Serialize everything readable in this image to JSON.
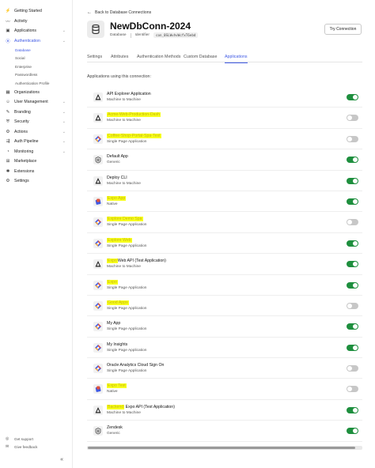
{
  "sidebar": {
    "items": [
      {
        "label": "Getting Started",
        "icon": "bolt-icon",
        "glyph": "⚡",
        "chevron": false
      },
      {
        "label": "Activity",
        "icon": "activity-icon",
        "glyph": "〰",
        "chevron": false
      },
      {
        "label": "Applications",
        "icon": "applications-icon",
        "glyph": "▣",
        "chevron": true
      },
      {
        "label": "Authentication",
        "icon": "authentication-icon",
        "glyph": "⦿",
        "chevron": true,
        "active": true
      }
    ],
    "sub_items": [
      {
        "label": "Database",
        "active": true
      },
      {
        "label": "Social"
      },
      {
        "label": "Enterprise"
      },
      {
        "label": "Passwordless"
      },
      {
        "label": "Authentication Profile"
      }
    ],
    "items2": [
      {
        "label": "Organizations",
        "icon": "organizations-icon",
        "glyph": "▦",
        "chevron": false
      },
      {
        "label": "User Management",
        "icon": "users-icon",
        "glyph": "☺",
        "chevron": true
      },
      {
        "label": "Branding",
        "icon": "branding-icon",
        "glyph": "✎",
        "chevron": true
      },
      {
        "label": "Security",
        "icon": "shield-icon",
        "glyph": "⛨",
        "chevron": true
      },
      {
        "label": "Actions",
        "icon": "actions-icon",
        "glyph": "⚙",
        "chevron": true
      },
      {
        "label": "Auth Pipeline",
        "icon": "pipeline-icon",
        "glyph": "⇶",
        "chevron": true
      },
      {
        "label": "Monitoring",
        "icon": "monitoring-icon",
        "glyph": "◔",
        "chevron": true
      },
      {
        "label": "Marketplace",
        "icon": "marketplace-icon",
        "glyph": "⊞",
        "chevron": false
      },
      {
        "label": "Extensions",
        "icon": "extensions-icon",
        "glyph": "✱",
        "chevron": false
      },
      {
        "label": "Settings",
        "icon": "settings-icon",
        "glyph": "⚙",
        "chevron": false
      }
    ],
    "footer": [
      {
        "label": "Get support",
        "icon": "support-icon",
        "glyph": "◎"
      },
      {
        "label": "Give feedback",
        "icon": "feedback-icon",
        "glyph": "✉"
      }
    ],
    "collapse_glyph": "«"
  },
  "header": {
    "back_label": "Back to Database Connections",
    "title": "NewDbConn-2024",
    "type_label": "Database",
    "identifier_label": "Identifier",
    "identifier_value": "con_0SLWvhvWcfxT6ebd",
    "try_button": "Try Connection"
  },
  "tabs": [
    {
      "label": "Settings"
    },
    {
      "label": "Attributes"
    },
    {
      "label": "Authentication Methods"
    },
    {
      "label": "Custom Database"
    },
    {
      "label": "Applications",
      "active": true
    }
  ],
  "section_label": "Applications using this connection:",
  "apps": [
    {
      "name": "API Explorer Application",
      "type": "Machine to Machine",
      "icon": "auth0-logo-icon",
      "enabled": true
    },
    {
      "name": "Acme-Web-Production-Dash",
      "type": "Machine to Machine",
      "icon": "auth0-logo-icon",
      "enabled": false,
      "hl": true
    },
    {
      "name": "Coffee-Shop-Portal-Spa-Test",
      "type": "Single Page Application",
      "icon": "spa-logo-icon",
      "enabled": false,
      "hl": true
    },
    {
      "name": "Default App",
      "type": "Generic",
      "icon": "generic-app-icon",
      "enabled": true
    },
    {
      "name": "Deploy CLI",
      "type": "Machine to Machine",
      "icon": "auth0-logo-icon",
      "enabled": true
    },
    {
      "name": "Expo App",
      "type": "Native",
      "icon": "native-logo-icon",
      "enabled": true,
      "hl": true
    },
    {
      "name": "Explore Demo Spa",
      "type": "Single Page Application",
      "icon": "spa-logo-icon",
      "enabled": false,
      "hl": true
    },
    {
      "name": "Explore Web",
      "type": "Single Page Application",
      "icon": "spa-logo-icon",
      "enabled": true,
      "hl": true
    },
    {
      "name": "Expo",
      "name_suffix": "Web API (Test Application)",
      "type": "Machine to Machine",
      "icon": "auth0-logo-icon",
      "enabled": true,
      "hl": true
    },
    {
      "name": "Expo",
      "type": "Single Page Application",
      "icon": "spa-logo-icon",
      "enabled": true,
      "hl": true
    },
    {
      "name": "Good Apps",
      "type": "Single Page Application",
      "icon": "spa-logo-icon",
      "enabled": false,
      "hl": true
    },
    {
      "name": "My App",
      "type": "Single Page Application",
      "icon": "spa-logo-icon",
      "enabled": true
    },
    {
      "name": "My Insights",
      "type": "Single Page Application",
      "icon": "spa-logo-icon",
      "enabled": true
    },
    {
      "name": "Oracle Analytics Cloud Sign On",
      "type": "Single Page Application",
      "icon": "spa-logo-icon",
      "enabled": false
    },
    {
      "name": "Expo Test",
      "type": "Native",
      "icon": "native-logo-icon",
      "enabled": false,
      "hl": true
    },
    {
      "name": "Backend",
      "name_suffix": " Expo API (Test Application)",
      "type": "Machine to Machine",
      "icon": "auth0-logo-icon",
      "enabled": true,
      "hl": true
    },
    {
      "name": "Zendesk",
      "type": "Generic",
      "icon": "generic-app-icon",
      "enabled": true
    }
  ],
  "colors": {
    "accent": "#3f59e4",
    "toggle_on": "#1e8f3e",
    "toggle_off": "#c7c7c7",
    "highlight": "#f7ff1f"
  }
}
